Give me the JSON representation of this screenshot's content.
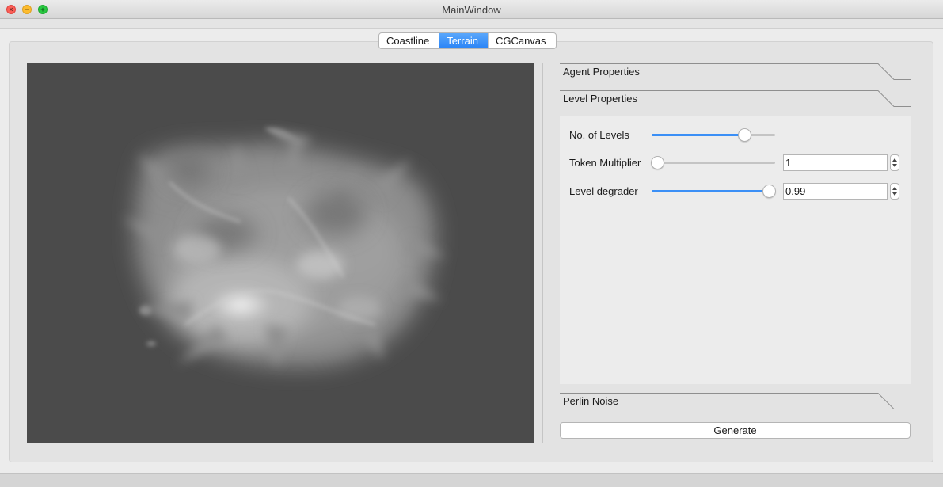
{
  "window": {
    "title": "MainWindow",
    "controls": [
      "close-icon",
      "minimize-icon",
      "maximize-icon"
    ]
  },
  "tabs": [
    {
      "label": "Coastline",
      "active": false
    },
    {
      "label": "Terrain",
      "active": true
    },
    {
      "label": "CGCanvas",
      "active": false
    }
  ],
  "colors": {
    "accent": "#2a84f6",
    "canvas_bg": "#4b4b4b",
    "panel_bg": "#ececec"
  },
  "toolbox": {
    "sections": [
      {
        "label": "Agent Properties",
        "expanded": false
      },
      {
        "label": "Level Properties",
        "expanded": true
      },
      {
        "label": "Perlin Noise",
        "expanded": false
      }
    ],
    "level_properties": {
      "levels": {
        "label": "No. of Levels",
        "slider_fraction": 0.75
      },
      "token_multiplier": {
        "label": "Token Multiplier",
        "value": "1",
        "slider_fraction": 0.0
      },
      "level_degrader": {
        "label": "Level degrader",
        "value": "0.99",
        "slider_fraction": 0.99
      }
    }
  },
  "generate_button": {
    "label": "Generate"
  }
}
